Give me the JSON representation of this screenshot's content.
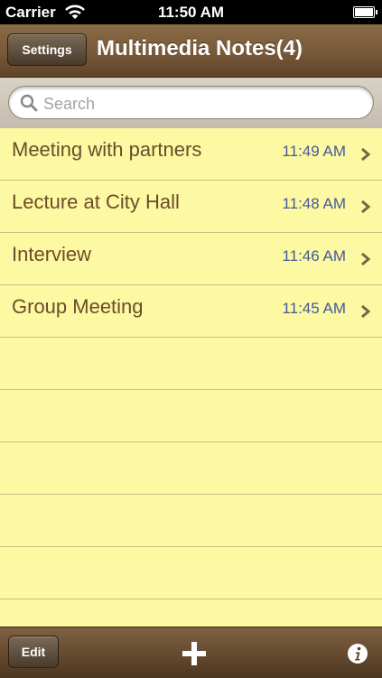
{
  "status_bar": {
    "carrier": "Carrier",
    "time": "11:50 AM"
  },
  "nav": {
    "settings_label": "Settings",
    "title": "Multimedia Notes(4)"
  },
  "search": {
    "placeholder": "Search",
    "value": ""
  },
  "notes": [
    {
      "title": "Meeting with partners",
      "time": "11:49 AM"
    },
    {
      "title": "Lecture at City Hall",
      "time": "11:48 AM"
    },
    {
      "title": "Interview",
      "time": "11:46 AM"
    },
    {
      "title": "Group Meeting",
      "time": "11:45 AM"
    }
  ],
  "toolbar": {
    "edit_label": "Edit",
    "add_icon": "plus-icon",
    "info_icon": "info-icon"
  },
  "colors": {
    "paper": "#fdf8a2",
    "note_title": "#6b4d29",
    "note_time": "#44599a",
    "bar_brown": "#7a5b3a"
  }
}
